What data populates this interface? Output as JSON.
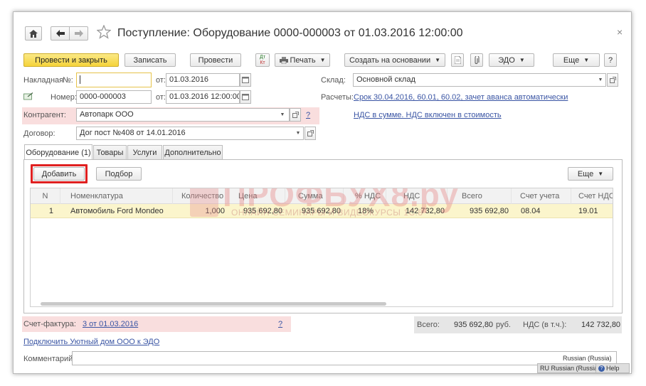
{
  "window": {
    "title": "Поступление: Оборудование 0000-000003 от 01.03.2016 12:00:00",
    "close_glyph": "×"
  },
  "toolbar": {
    "post_close": "Провести и закрыть",
    "save": "Записать",
    "post": "Провести",
    "dt_kt_top": "Дт",
    "dt_kt_bottom": "Кт",
    "print": "Печать",
    "create_based": "Создать на основании",
    "edo": "ЭДО",
    "more": "Еще",
    "help": "?"
  },
  "form": {
    "invoice_label": "Накладная",
    "invoice_no_label": "№:",
    "from_label": "от:",
    "invoice_date": "01.03.2016",
    "number_label": "Номер:",
    "number_value": "0000-000003",
    "number_date": "01.03.2016 12:00:00",
    "counterparty_label": "Контрагент:",
    "counterparty_value": "Автопарк ООО",
    "contract_label": "Договор:",
    "contract_value": "Дог пост №408 от 14.01.2016",
    "warehouse_label": "Склад:",
    "warehouse_value": "Основной склад",
    "settlements_label": "Расчеты:",
    "settlements_link": "Срок 30.04.2016, 60.01, 60.02, зачет аванса автоматически",
    "vat_link": "НДС в сумме. НДС включен в стоимость",
    "question": "?"
  },
  "tabs": [
    "Оборудование (1)",
    "Товары",
    "Услуги",
    "Дополнительно"
  ],
  "table_toolbar": {
    "add": "Добавить",
    "pick": "Подбор",
    "more": "Еще"
  },
  "watermark": {
    "title": "ПРОФБУХ8.ру",
    "subtitle": "ОНЛАЙН СЕМИНАРЫ И ВИДЕОКУРСЫ 1С:8"
  },
  "table": {
    "columns": [
      "N",
      "Номенклатура",
      "Количество",
      "Цена",
      "Сумма",
      "% НДС",
      "НДС",
      "Всего",
      "Счет учета",
      "Счет НДС"
    ],
    "rows": [
      [
        "1",
        "Автомобиль Ford Mondeo",
        "1,000",
        "935 692,80",
        "935 692,80",
        "18%",
        "142 732,80",
        "935 692,80",
        "08.04",
        "19.01"
      ]
    ]
  },
  "footer": {
    "sf_label": "Счет-фактура:",
    "sf_link": "3 от 01.03.2016",
    "sf_question": "?",
    "total_label": "Всего:",
    "total_value": "935 692,80",
    "currency": "руб.",
    "vat_label": "НДС (в т.ч.):",
    "vat_value": "142 732,80",
    "edo_link": "Подключить Уютный дом ООО к ЭДО",
    "comment_label": "Комментарий:"
  },
  "statusbar": {
    "lang_tooltip": "Russian (Russia)",
    "lang": "RU Russian (Russia)",
    "help": "Help"
  }
}
